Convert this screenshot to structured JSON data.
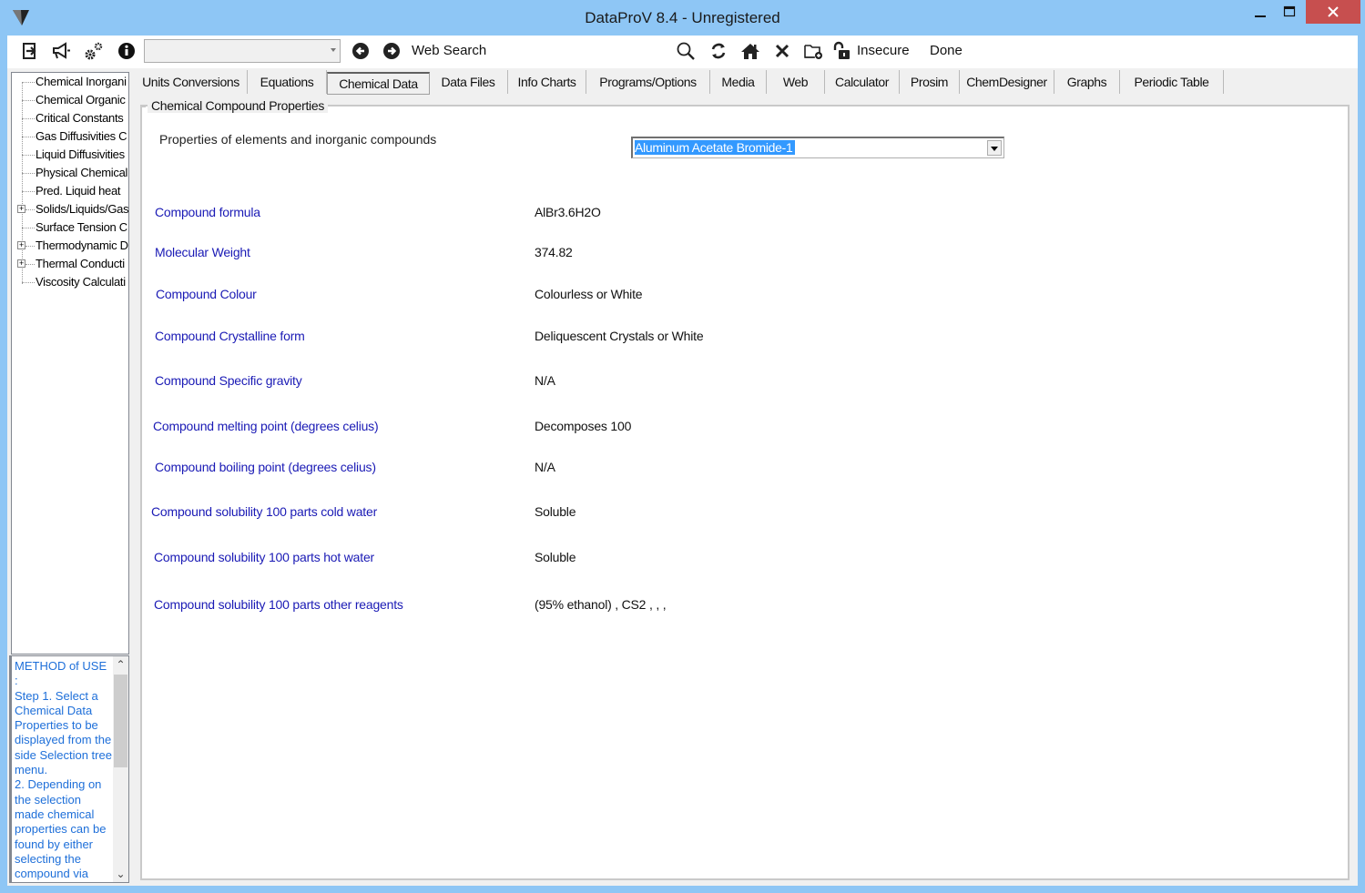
{
  "window": {
    "title": "DataProV 8.4 - Unregistered",
    "controls": {
      "minimize": "minimize",
      "maximize": "maximize",
      "close": "close"
    }
  },
  "toolbar": {
    "left_icons": [
      "exit-icon",
      "megaphone-icon",
      "settings-gears-icon",
      "info-icon"
    ],
    "address_combo_value": "",
    "back_icon": "back-arrow-icon",
    "forward_icon": "forward-arrow-icon",
    "web_search_label": "Web Search",
    "right_icons": [
      "search-icon",
      "refresh-icon",
      "home-icon",
      "close-icon",
      "new-folder-icon",
      "unlock-icon"
    ],
    "security_label": "Insecure",
    "status_label": "Done"
  },
  "sidebar": {
    "tree_items": [
      {
        "label": "Chemical Inorgani",
        "expandable": false
      },
      {
        "label": "Chemical Organic",
        "expandable": false
      },
      {
        "label": "Critical Constants",
        "expandable": false
      },
      {
        "label": "Gas Diffusivities C",
        "expandable": false
      },
      {
        "label": "Liquid Diffusivities",
        "expandable": false
      },
      {
        "label": "Physical Chemical",
        "expandable": false
      },
      {
        "label": "Pred. Liquid heat",
        "expandable": false
      },
      {
        "label": "Solids/Liquids/Gas",
        "expandable": true
      },
      {
        "label": "Surface Tension C",
        "expandable": false
      },
      {
        "label": "Thermodynamic D",
        "expandable": true
      },
      {
        "label": "Thermal Conducti",
        "expandable": true
      },
      {
        "label": "Viscosity Calculati",
        "expandable": false
      }
    ],
    "method_of_use": "METHOD of USE\n:\nStep 1. Select a Chemical Data Properties to be displayed from the side Selection tree menu.\n2. Depending on the selection made chemical properties can be found by either selecting the compound via"
  },
  "tabs": [
    {
      "label": "Units Conversions",
      "active": false
    },
    {
      "label": "Equations",
      "active": false
    },
    {
      "label": "Chemical Data",
      "active": true
    },
    {
      "label": "Data Files",
      "active": false
    },
    {
      "label": "Info Charts",
      "active": false
    },
    {
      "label": "Programs/Options",
      "active": false
    },
    {
      "label": "Media",
      "active": false
    },
    {
      "label": "Web",
      "active": false
    },
    {
      "label": "Calculator",
      "active": false
    },
    {
      "label": "Prosim",
      "active": false
    },
    {
      "label": "ChemDesigner",
      "active": false
    },
    {
      "label": "Graphs",
      "active": false
    },
    {
      "label": "Periodic Table",
      "active": false
    }
  ],
  "main": {
    "groupbox_title": "Chemical Compound Properties",
    "subheading": "Properties of elements and inorganic compounds",
    "compound_select_value": "Aluminum Acetate Bromide-1",
    "properties": [
      {
        "label": "Compound formula",
        "value": "AlBr3.6H2O"
      },
      {
        "label": "Molecular Weight",
        "value": "374.82"
      },
      {
        "label": "Compound Colour",
        "value": "Colourless or White"
      },
      {
        "label": "Compound Crystalline form",
        "value": "Deliquescent Crystals or White"
      },
      {
        "label": "Compound Specific gravity",
        "value": "N/A"
      },
      {
        "label": "Compound melting point (degrees celius)",
        "value": "Decomposes 100"
      },
      {
        "label": "Compound boiling point (degrees celius)",
        "value": "N/A"
      },
      {
        "label": "Compound solubility 100 parts cold water",
        "value": "Soluble"
      },
      {
        "label": "Compound solubility 100 parts hot water",
        "value": "Soluble"
      },
      {
        "label": "Compound solubility 100 parts other reagents",
        "value": "(95% ethanol) , CS2 ,    ,    ,"
      }
    ]
  }
}
